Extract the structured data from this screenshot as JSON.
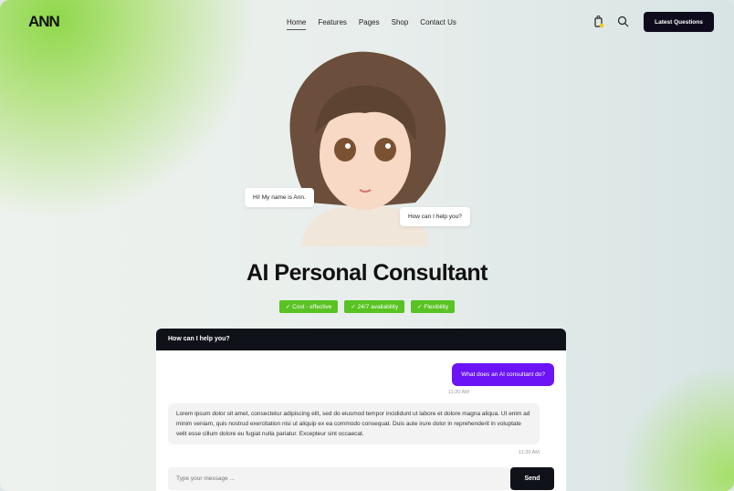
{
  "header": {
    "logo": "ANN",
    "nav": [
      "Home",
      "Features",
      "Pages",
      "Shop",
      "Contact Us"
    ],
    "cta": "Latest Questions"
  },
  "hero": {
    "bubble_left": "Hi! My name is Ann.",
    "bubble_right": "How can I help you?",
    "title": "AI Personal Consultant",
    "tags": [
      "Cost - effective",
      "24/7 availability",
      "Flexibility"
    ]
  },
  "chat": {
    "header": "How can I help you?",
    "user_message": "What does an AI consultant do?",
    "user_time": "11:20 AM",
    "bot_message": "Lorem ipsum dolor sit amet, consectetur adipiscing elit, sed do eiusmod tempor incididunt ut labore et dolore magna aliqua. Ut enim ad minim veniam, quis nostrud exercitation nisi ut aliquip ex ea commodo consequat. Duis aute irure dolor in reprehenderit in voluptate velit esse cillum dolore eu fugiat nulla pariatur. Excepteur sint occaecat.",
    "bot_time": "11:20 AM",
    "placeholder": "Type your message ...",
    "send": "Send"
  }
}
